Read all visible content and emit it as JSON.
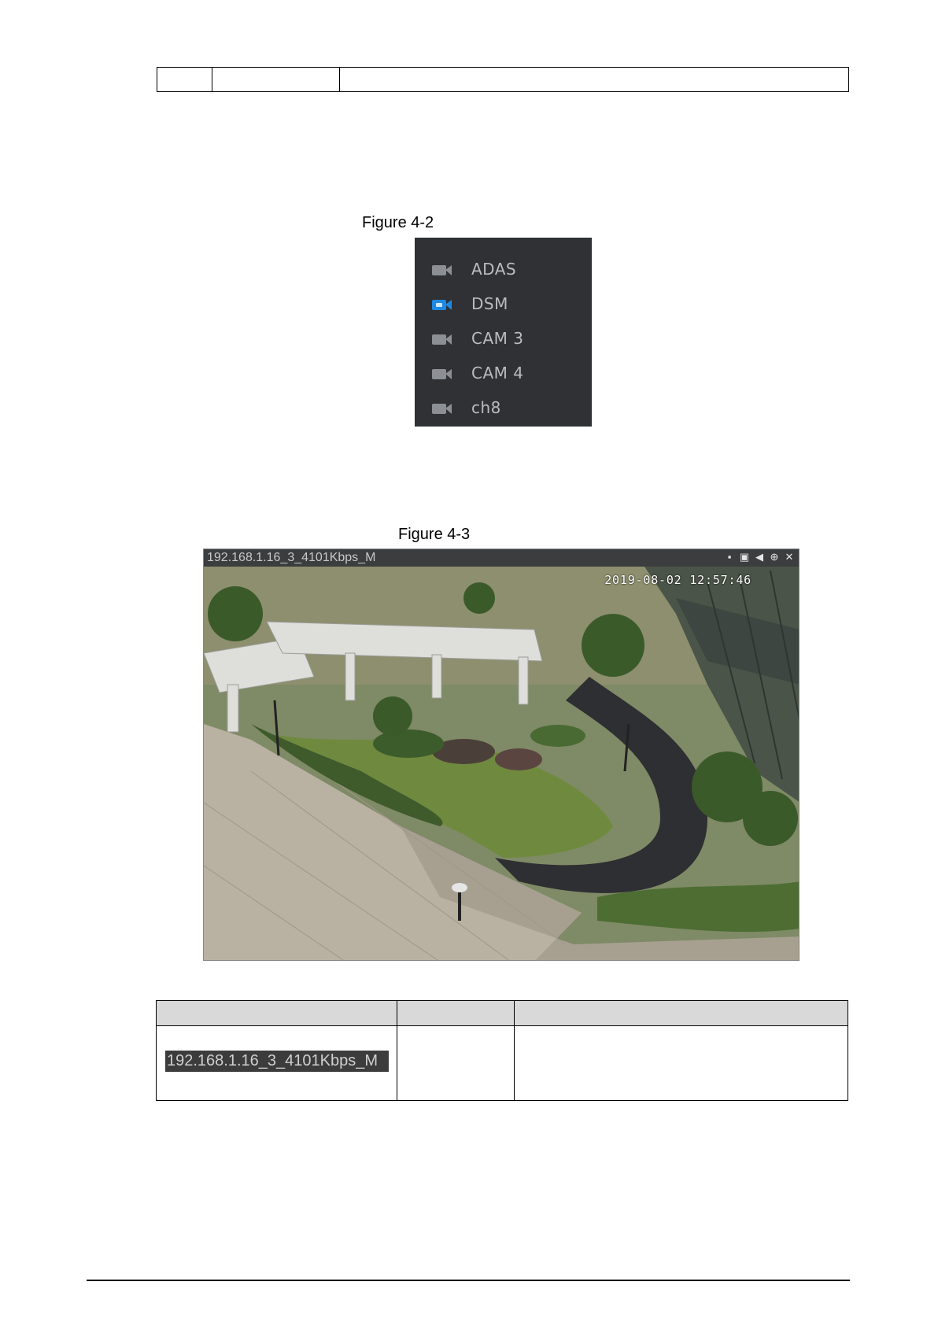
{
  "figures": [
    {
      "caption": "Figure 4-2"
    },
    {
      "caption": "Figure 4-3"
    }
  ],
  "camera_list": {
    "items": [
      {
        "label": "ADAS",
        "icon": "camera-icon",
        "active": false
      },
      {
        "label": "DSM",
        "icon": "camera-icon",
        "active": true
      },
      {
        "label": "CAM 3",
        "icon": "camera-icon",
        "active": false
      },
      {
        "label": "CAM 4",
        "icon": "camera-icon",
        "active": false
      },
      {
        "label": "ch8",
        "icon": "camera-icon",
        "active": false
      }
    ],
    "colors": {
      "panel": "#2f3135",
      "active": "#1e88e5",
      "inactive": "#8c8f94"
    }
  },
  "video": {
    "title": "192.168.1.16_3_4101Kbps_M",
    "timestamp": "2019-08-02 12:57:46",
    "tools": [
      "record-icon",
      "snapshot-icon",
      "audio-icon",
      "zoom-icon",
      "close-icon"
    ]
  },
  "table": {
    "row": {
      "ip_label": "192.168.1.16_3_4101Kbps_M"
    }
  }
}
